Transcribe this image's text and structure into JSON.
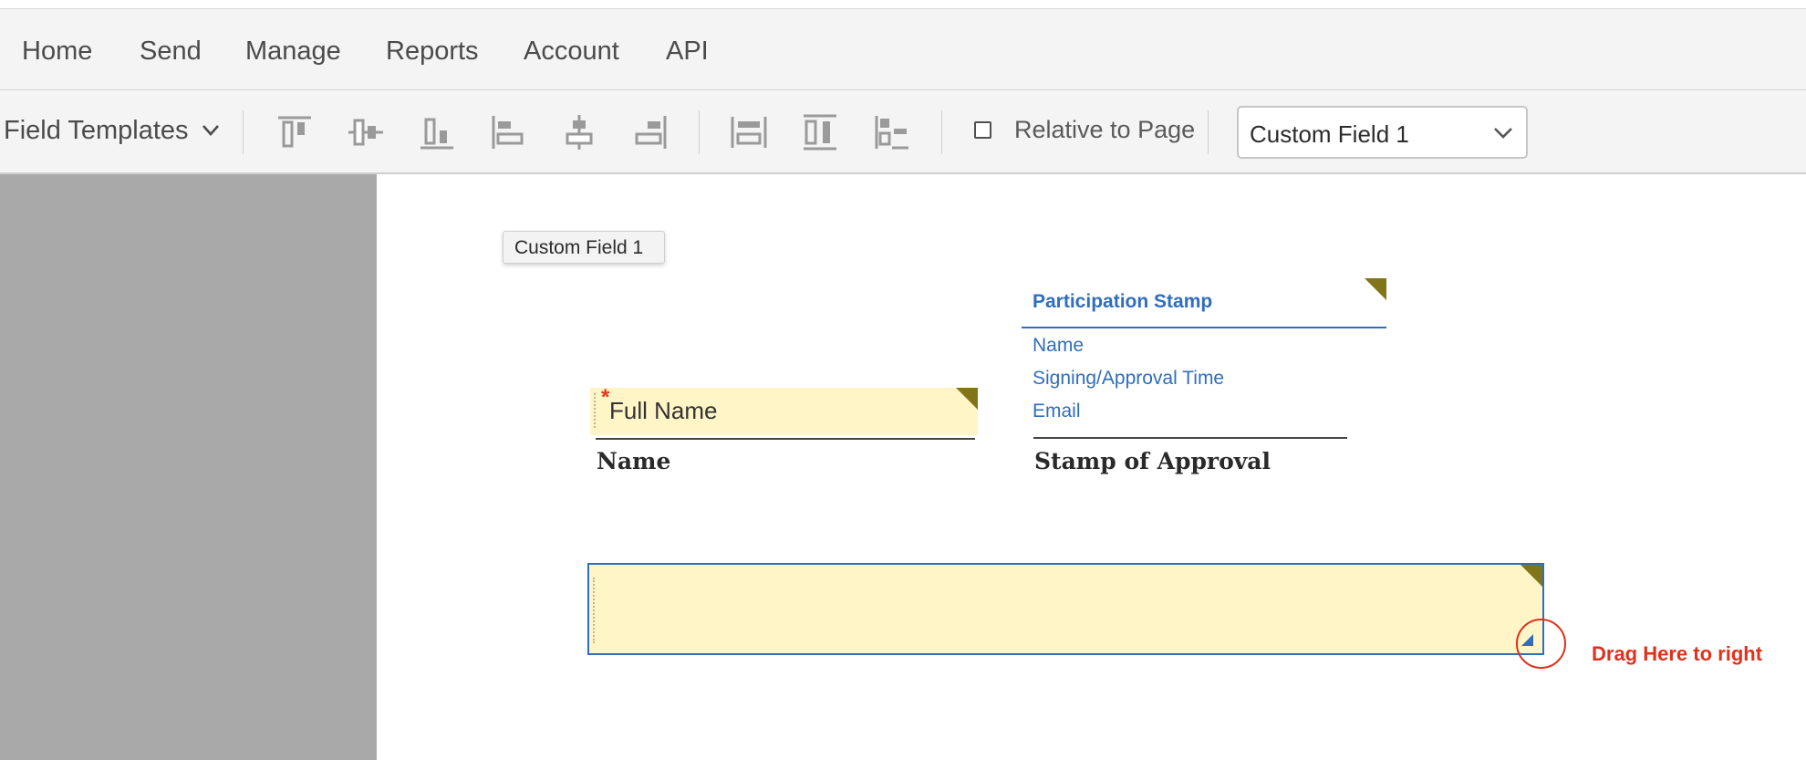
{
  "nav": {
    "items": [
      "Home",
      "Send",
      "Manage",
      "Reports",
      "Account",
      "API"
    ]
  },
  "toolbar": {
    "field_templates_label": "Field Templates",
    "align_icons": [
      "align-top-icon",
      "align-middle-icon",
      "align-bottom-icon",
      "align-left-icon",
      "align-center-icon",
      "align-right-icon"
    ],
    "distribute_icons": [
      "match-width-icon",
      "match-height-icon",
      "distribute-icon"
    ],
    "relative_to_page_label": "Relative to Page",
    "relative_to_page_checked": false,
    "field_select_value": "Custom Field 1"
  },
  "document": {
    "tooltip": "Custom Field 1",
    "stamp": {
      "title": "Participation Stamp",
      "items": [
        "Name",
        "Signing/Approval Time",
        "Email"
      ]
    },
    "full_name_field": {
      "text": "Full Name",
      "required_marker": "*"
    },
    "name_caption": "Name",
    "stamp_caption": "Stamp of Approval",
    "drag_hint": "Drag Here to right"
  },
  "colors": {
    "field_fill": "#fff5c7",
    "accent_blue": "#2f6ebc",
    "corner_marker": "#827418",
    "hint_red": "#e0311c",
    "sidebar_gray": "#a9a9a9"
  }
}
